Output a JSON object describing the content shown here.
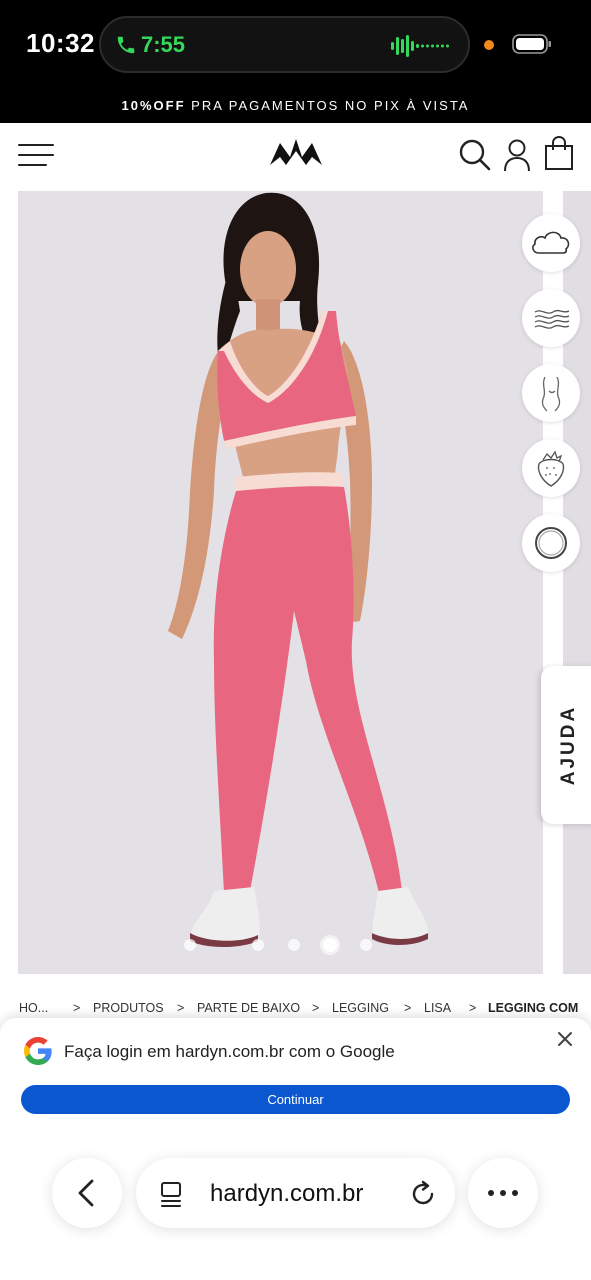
{
  "status_bar": {
    "time": "10:32",
    "call_timer": "7:55",
    "icons": [
      "phone-icon",
      "audio-wave-icon",
      "battery-icon"
    ]
  },
  "promo": {
    "highlight": "10%OFF",
    "text": " PRA PAGAMENTOS NO PIX À VISTA"
  },
  "header": {
    "icons": [
      "menu-icon",
      "crown-logo-icon",
      "search-icon",
      "account-icon",
      "shopping-bag-icon"
    ]
  },
  "gallery": {
    "slide_count": 5,
    "active_slide": 4,
    "colors": {
      "product": "#e8667f",
      "trim": "#f6dcd2",
      "background": "#e3e0e6"
    }
  },
  "features": {
    "icons": [
      "cloud-icon",
      "fabric-wave-icon",
      "body-contour-icon",
      "strawberry-icon",
      "ring-icon"
    ]
  },
  "help": {
    "label": "AJUDA"
  },
  "breadcrumb": {
    "items": [
      "HO...",
      "PRODUTOS",
      "PARTE DE BAIXO",
      "LEGGING",
      "LISA"
    ],
    "current": "LEGGING COM",
    "separator": ">"
  },
  "google_prompt": {
    "title": "Faça login em hardyn.com.br com o Google",
    "button": "Continuar",
    "colors": {
      "button": "#0b57d0"
    }
  },
  "browser": {
    "url": "hardyn.com.br",
    "icons": [
      "back-icon",
      "tabs-icon",
      "reload-icon",
      "more-icon"
    ]
  }
}
